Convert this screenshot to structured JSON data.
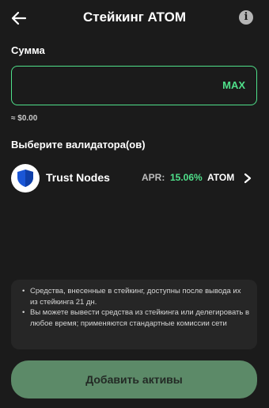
{
  "header": {
    "title": "Стейкинг ATOM",
    "back_icon": "arrow-left-icon",
    "info_icon": "info-icon",
    "info_glyph": "i"
  },
  "amount": {
    "label": "Сумма",
    "value": "",
    "max_label": "MAX",
    "fiat_approx": "≈ $0.00"
  },
  "validators": {
    "label": "Выберите валидатора(ов)",
    "items": [
      {
        "name": "Trust Nodes",
        "apr_label": "APR:",
        "apr_value": "15.06%",
        "apr_unit": "ATOM",
        "icon": "shield-icon"
      }
    ]
  },
  "notice": {
    "items": [
      "Средства, внесенные в стейкинг, доступны после вывода их из стейкинга 21 дн.",
      "Вы можете вывести средства из стейкинга или делегировать в любое время; применяются стандартные комиссии сети"
    ]
  },
  "submit": {
    "label": "Добавить активы"
  },
  "colors": {
    "background": "#1b1b1b",
    "accent": "#4fe08a",
    "button": "#5c8a68",
    "shield": "#1a56d6"
  }
}
